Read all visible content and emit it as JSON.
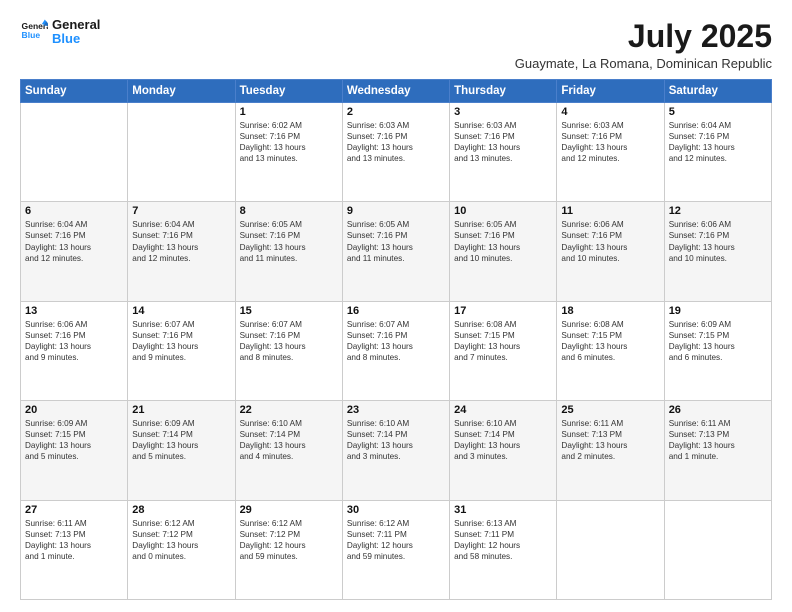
{
  "header": {
    "logo_line1": "General",
    "logo_line2": "Blue",
    "title": "July 2025",
    "subtitle": "Guaymate, La Romana, Dominican Republic"
  },
  "weekdays": [
    "Sunday",
    "Monday",
    "Tuesday",
    "Wednesday",
    "Thursday",
    "Friday",
    "Saturday"
  ],
  "weeks": [
    [
      {
        "day": "",
        "detail": ""
      },
      {
        "day": "",
        "detail": ""
      },
      {
        "day": "1",
        "detail": "Sunrise: 6:02 AM\nSunset: 7:16 PM\nDaylight: 13 hours\nand 13 minutes."
      },
      {
        "day": "2",
        "detail": "Sunrise: 6:03 AM\nSunset: 7:16 PM\nDaylight: 13 hours\nand 13 minutes."
      },
      {
        "day": "3",
        "detail": "Sunrise: 6:03 AM\nSunset: 7:16 PM\nDaylight: 13 hours\nand 13 minutes."
      },
      {
        "day": "4",
        "detail": "Sunrise: 6:03 AM\nSunset: 7:16 PM\nDaylight: 13 hours\nand 12 minutes."
      },
      {
        "day": "5",
        "detail": "Sunrise: 6:04 AM\nSunset: 7:16 PM\nDaylight: 13 hours\nand 12 minutes."
      }
    ],
    [
      {
        "day": "6",
        "detail": "Sunrise: 6:04 AM\nSunset: 7:16 PM\nDaylight: 13 hours\nand 12 minutes."
      },
      {
        "day": "7",
        "detail": "Sunrise: 6:04 AM\nSunset: 7:16 PM\nDaylight: 13 hours\nand 12 minutes."
      },
      {
        "day": "8",
        "detail": "Sunrise: 6:05 AM\nSunset: 7:16 PM\nDaylight: 13 hours\nand 11 minutes."
      },
      {
        "day": "9",
        "detail": "Sunrise: 6:05 AM\nSunset: 7:16 PM\nDaylight: 13 hours\nand 11 minutes."
      },
      {
        "day": "10",
        "detail": "Sunrise: 6:05 AM\nSunset: 7:16 PM\nDaylight: 13 hours\nand 10 minutes."
      },
      {
        "day": "11",
        "detail": "Sunrise: 6:06 AM\nSunset: 7:16 PM\nDaylight: 13 hours\nand 10 minutes."
      },
      {
        "day": "12",
        "detail": "Sunrise: 6:06 AM\nSunset: 7:16 PM\nDaylight: 13 hours\nand 10 minutes."
      }
    ],
    [
      {
        "day": "13",
        "detail": "Sunrise: 6:06 AM\nSunset: 7:16 PM\nDaylight: 13 hours\nand 9 minutes."
      },
      {
        "day": "14",
        "detail": "Sunrise: 6:07 AM\nSunset: 7:16 PM\nDaylight: 13 hours\nand 9 minutes."
      },
      {
        "day": "15",
        "detail": "Sunrise: 6:07 AM\nSunset: 7:16 PM\nDaylight: 13 hours\nand 8 minutes."
      },
      {
        "day": "16",
        "detail": "Sunrise: 6:07 AM\nSunset: 7:16 PM\nDaylight: 13 hours\nand 8 minutes."
      },
      {
        "day": "17",
        "detail": "Sunrise: 6:08 AM\nSunset: 7:15 PM\nDaylight: 13 hours\nand 7 minutes."
      },
      {
        "day": "18",
        "detail": "Sunrise: 6:08 AM\nSunset: 7:15 PM\nDaylight: 13 hours\nand 6 minutes."
      },
      {
        "day": "19",
        "detail": "Sunrise: 6:09 AM\nSunset: 7:15 PM\nDaylight: 13 hours\nand 6 minutes."
      }
    ],
    [
      {
        "day": "20",
        "detail": "Sunrise: 6:09 AM\nSunset: 7:15 PM\nDaylight: 13 hours\nand 5 minutes."
      },
      {
        "day": "21",
        "detail": "Sunrise: 6:09 AM\nSunset: 7:14 PM\nDaylight: 13 hours\nand 5 minutes."
      },
      {
        "day": "22",
        "detail": "Sunrise: 6:10 AM\nSunset: 7:14 PM\nDaylight: 13 hours\nand 4 minutes."
      },
      {
        "day": "23",
        "detail": "Sunrise: 6:10 AM\nSunset: 7:14 PM\nDaylight: 13 hours\nand 3 minutes."
      },
      {
        "day": "24",
        "detail": "Sunrise: 6:10 AM\nSunset: 7:14 PM\nDaylight: 13 hours\nand 3 minutes."
      },
      {
        "day": "25",
        "detail": "Sunrise: 6:11 AM\nSunset: 7:13 PM\nDaylight: 13 hours\nand 2 minutes."
      },
      {
        "day": "26",
        "detail": "Sunrise: 6:11 AM\nSunset: 7:13 PM\nDaylight: 13 hours\nand 1 minute."
      }
    ],
    [
      {
        "day": "27",
        "detail": "Sunrise: 6:11 AM\nSunset: 7:13 PM\nDaylight: 13 hours\nand 1 minute."
      },
      {
        "day": "28",
        "detail": "Sunrise: 6:12 AM\nSunset: 7:12 PM\nDaylight: 13 hours\nand 0 minutes."
      },
      {
        "day": "29",
        "detail": "Sunrise: 6:12 AM\nSunset: 7:12 PM\nDaylight: 12 hours\nand 59 minutes."
      },
      {
        "day": "30",
        "detail": "Sunrise: 6:12 AM\nSunset: 7:11 PM\nDaylight: 12 hours\nand 59 minutes."
      },
      {
        "day": "31",
        "detail": "Sunrise: 6:13 AM\nSunset: 7:11 PM\nDaylight: 12 hours\nand 58 minutes."
      },
      {
        "day": "",
        "detail": ""
      },
      {
        "day": "",
        "detail": ""
      }
    ]
  ]
}
